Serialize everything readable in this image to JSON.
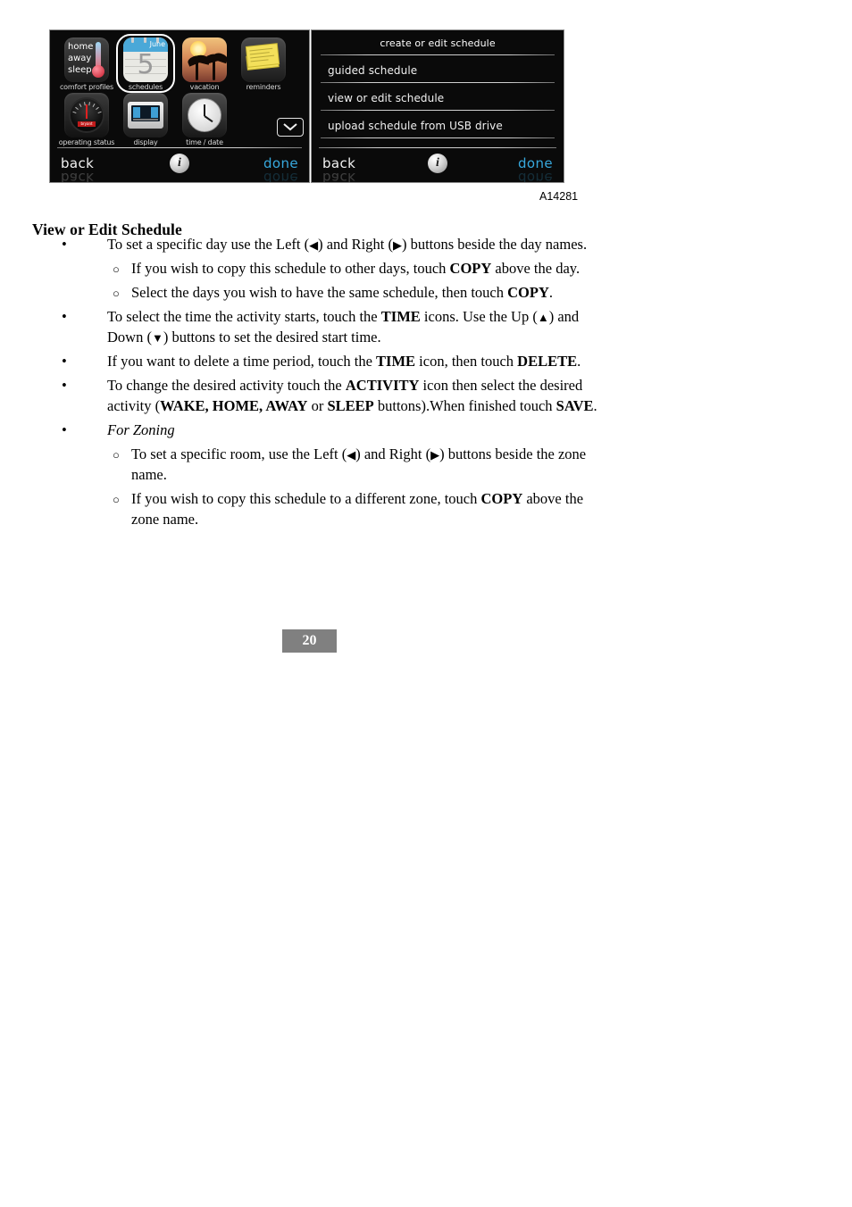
{
  "figure": {
    "id_label": "A14281",
    "left_screen": {
      "title": "menu screen",
      "icons": [
        {
          "label": "comfort profiles",
          "icon": "comfort-profiles-icon",
          "selected": false,
          "lines": [
            "home",
            "away",
            "sleep"
          ]
        },
        {
          "label": "schedules",
          "icon": "calendar-icon",
          "selected": true,
          "month": "June",
          "day": "5"
        },
        {
          "label": "vacation",
          "icon": "palm-trees-icon",
          "selected": false
        },
        {
          "label": "reminders",
          "icon": "sticky-notes-icon",
          "selected": false
        },
        {
          "label": "operating status",
          "icon": "gauge-icon",
          "selected": false,
          "badge": "bryant"
        },
        {
          "label": "display",
          "icon": "thermostat-device-icon",
          "selected": false
        },
        {
          "label": "time / date",
          "icon": "clock-icon",
          "selected": false
        }
      ],
      "scroll_down": "chevron-down-icon",
      "footer": {
        "back": "back",
        "info": "i",
        "done": "done"
      }
    },
    "right_screen": {
      "title": "create or edit schedule",
      "items": [
        "guided schedule",
        "view or edit schedule",
        "upload schedule from USB drive"
      ],
      "footer": {
        "back": "back",
        "info": "i",
        "done": "done"
      }
    },
    "colors": {
      "screen_background": "#0a0a0a",
      "accent_done": "#37a8dd",
      "calendar_header": "#4aa8d8",
      "note_yellow": "#f3e05a",
      "page_badge": "#808080"
    }
  },
  "section": {
    "heading": "View or Edit Schedule"
  },
  "bullets": [
    {
      "level": 1,
      "html": "To set a specific day use the Left (<span class=\"tri\">◀</span>) and Right (<span class=\"tri\">▶</span>) buttons beside the day names."
    },
    {
      "level": 2,
      "html": "If you wish to copy this schedule to other days, touch <b>COPY</b> above the day."
    },
    {
      "level": 2,
      "html": "Select the days you wish to have the same schedule, then touch <b>COPY</b>."
    },
    {
      "level": 1,
      "html": "To select the time the activity starts, touch the <b>TIME</b> icons. Use the Up (<span class=\"tri\">▲</span>) and Down (<span class=\"tri\">▼</span>) buttons to set the desired start time."
    },
    {
      "level": 1,
      "html": "If you want to delete a time period, touch the <b>TIME</b> icon, then touch <b>DELETE</b>."
    },
    {
      "level": 1,
      "html": "To change the desired activity touch the <b>ACTIVITY</b> icon then select the desired activity (<b>WAKE, HOME, AWAY</b> or <b>SLEEP</b> buttons).When finished touch <b>SAVE</b>."
    },
    {
      "level": 1,
      "html": "<i>For Zoning</i>"
    },
    {
      "level": 2,
      "html": "To set a specific room, use the Left (<span class=\"tri\">◀</span>) and Right (<span class=\"tri\">▶</span>) buttons beside the zone name."
    },
    {
      "level": 2,
      "html": "If you wish to copy this schedule to a different zone, touch <b>COPY</b> above the zone name."
    }
  ],
  "markers": {
    "level1": "•",
    "level2": "○"
  },
  "footer": {
    "page_number": "20"
  }
}
